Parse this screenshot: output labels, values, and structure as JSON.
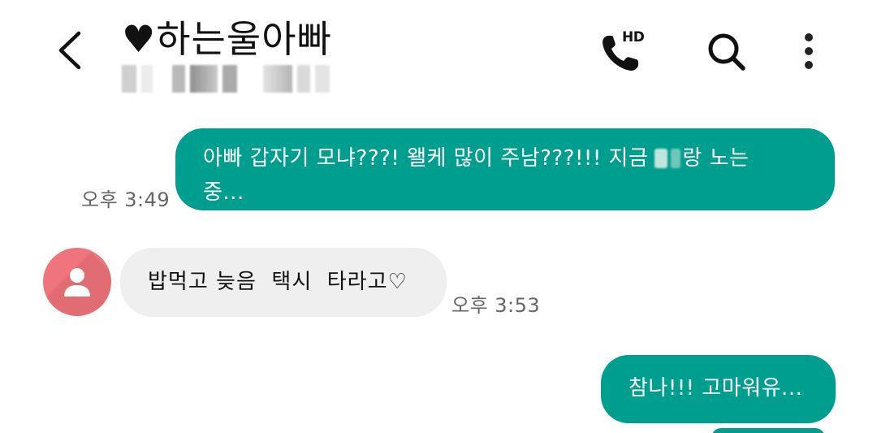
{
  "header": {
    "title": "♥하는울아빠",
    "hd_label": "HD"
  },
  "messages": [
    {
      "direction": "out",
      "line1": "아빠 갑자기 모냐???! 왤케 많이 주남???!!! 지금",
      "line1_after": "랑 노는",
      "line2": "중...",
      "time": "오후 3:49"
    },
    {
      "direction": "in",
      "text": "밥먹고 늦음  택시  타라고♡",
      "time": "오후 3:53"
    },
    {
      "direction": "out",
      "text": "참나!!! 고마워유..."
    }
  ],
  "colors": {
    "outgoing_bubble": "#009e8e",
    "incoming_bubble": "#efefef",
    "avatar": "#f0747b"
  }
}
